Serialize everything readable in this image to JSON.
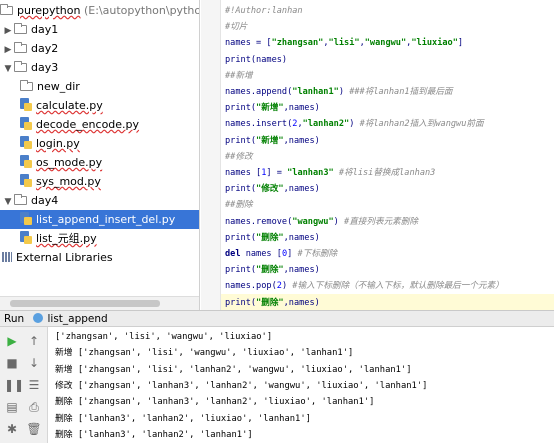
{
  "project_tree": {
    "root": {
      "name": "purepython",
      "path": "(E:\\autopython\\pythoncod"
    },
    "items": [
      {
        "label": "day1",
        "kind": "folder",
        "expanded": false,
        "depth": 0
      },
      {
        "label": "day2",
        "kind": "folder",
        "expanded": false,
        "depth": 0
      },
      {
        "label": "day3",
        "kind": "folder",
        "expanded": true,
        "depth": 0
      },
      {
        "label": "new_dir",
        "kind": "folder",
        "depth": 1
      },
      {
        "label": "calculate.py",
        "kind": "python",
        "depth": 1
      },
      {
        "label": "decode_encode.py",
        "kind": "python",
        "depth": 1
      },
      {
        "label": "login.py",
        "kind": "python",
        "depth": 1
      },
      {
        "label": "os_mode.py",
        "kind": "python",
        "depth": 1
      },
      {
        "label": "sys_mod.py",
        "kind": "python",
        "depth": 1
      },
      {
        "label": "day4",
        "kind": "folder",
        "expanded": true,
        "depth": 0
      },
      {
        "label": "list_append_insert_del.py",
        "kind": "python",
        "depth": 1,
        "selected": true
      },
      {
        "label": "list_元组.py",
        "kind": "python",
        "depth": 1
      },
      {
        "label": "External Libraries",
        "kind": "library",
        "depth": 0
      }
    ]
  },
  "editor": {
    "lines": [
      {
        "seg": [
          [
            "#!Author:lanhan",
            "cm"
          ]
        ]
      },
      {
        "seg": [
          [
            "#切片",
            "cm"
          ]
        ]
      },
      {
        "seg": [
          [
            "names = [",
            "bl"
          ],
          [
            "\"zhangsan\"",
            "st"
          ],
          [
            ",",
            "bl"
          ],
          [
            "\"lisi\"",
            "st"
          ],
          [
            ",",
            "bl"
          ],
          [
            "\"wangwu\"",
            "st"
          ],
          [
            ",",
            "bl"
          ],
          [
            "\"liuxiao\"",
            "st"
          ],
          [
            "]",
            "bl"
          ]
        ]
      },
      {
        "seg": [
          [
            "print(names)",
            "bl"
          ]
        ]
      },
      {
        "seg": [
          [
            "##新增",
            "cm"
          ]
        ]
      },
      {
        "seg": [
          [
            "names.append(",
            "bl"
          ],
          [
            "\"lanhan1\"",
            "st"
          ],
          [
            ")  ",
            "bl"
          ],
          [
            "###将lanhan1插到最后面",
            "cm"
          ]
        ]
      },
      {
        "seg": [
          [
            "print(",
            "bl"
          ],
          [
            "\"新增\"",
            "st"
          ],
          [
            ",names)",
            "bl"
          ]
        ]
      },
      {
        "seg": [
          [
            "names.insert(",
            "bl"
          ],
          [
            "2",
            "nm"
          ],
          [
            ",",
            "bl"
          ],
          [
            "\"lanhan2\"",
            "st"
          ],
          [
            ")  ",
            "bl"
          ],
          [
            "#将lanhan2插入到wangwu前面",
            "cm"
          ]
        ]
      },
      {
        "seg": [
          [
            "print(",
            "bl"
          ],
          [
            "\"新增\"",
            "st"
          ],
          [
            ",names)",
            "bl"
          ]
        ]
      },
      {
        "seg": [
          [
            "##修改",
            "cm"
          ]
        ]
      },
      {
        "seg": [
          [
            "names [",
            "bl"
          ],
          [
            "1",
            "nm"
          ],
          [
            "] = ",
            "bl"
          ],
          [
            "\"lanhan3\"",
            "st"
          ],
          [
            "  ",
            "bl"
          ],
          [
            "#将lisi替换成lanhan3",
            "cm"
          ]
        ]
      },
      {
        "seg": [
          [
            "print(",
            "bl"
          ],
          [
            "\"修改\"",
            "st"
          ],
          [
            ",names)",
            "bl"
          ]
        ]
      },
      {
        "seg": [
          [
            "##删除",
            "cm"
          ]
        ]
      },
      {
        "seg": [
          [
            "names.remove(",
            "bl"
          ],
          [
            "\"wangwu\"",
            "st"
          ],
          [
            ")     ",
            "bl"
          ],
          [
            "#直接列表元素删除",
            "cm"
          ]
        ]
      },
      {
        "seg": [
          [
            "print(",
            "bl"
          ],
          [
            "\"删除\"",
            "st"
          ],
          [
            ",names)",
            "bl"
          ]
        ]
      },
      {
        "seg": [
          [
            "del",
            "kw"
          ],
          [
            " names [",
            "bl"
          ],
          [
            "0",
            "nm"
          ],
          [
            "]     ",
            "bl"
          ],
          [
            "#下标删除",
            "cm"
          ]
        ]
      },
      {
        "seg": [
          [
            "print(",
            "bl"
          ],
          [
            "\"删除\"",
            "st"
          ],
          [
            ",names)",
            "bl"
          ]
        ]
      },
      {
        "seg": [
          [
            "names.pop(",
            "bl"
          ],
          [
            "2",
            "nm"
          ],
          [
            ")     ",
            "bl"
          ],
          [
            "#输入下标删除（不输入下标，默认删除最后一个元素）",
            "cm"
          ]
        ]
      },
      {
        "seg": [
          [
            "print(",
            "bl"
          ],
          [
            "\"删除\"",
            "st"
          ],
          [
            ",names)",
            "bl"
          ]
        ],
        "current": true
      }
    ]
  },
  "run_bar": {
    "label": "Run",
    "config": "list_append"
  },
  "console": {
    "lines": [
      "['zhangsan', 'lisi', 'wangwu', 'liuxiao']",
      "新增 ['zhangsan', 'lisi', 'wangwu', 'liuxiao', 'lanhan1']",
      "新增 ['zhangsan', 'lisi', 'lanhan2', 'wangwu', 'liuxiao', 'lanhan1']",
      "修改 ['zhangsan', 'lanhan3', 'lanhan2', 'wangwu', 'liuxiao', 'lanhan1']",
      "删除 ['zhangsan', 'lanhan3', 'lanhan2', 'liuxiao', 'lanhan1']",
      "删除 ['lanhan3', 'lanhan2', 'liuxiao', 'lanhan1']",
      "删除 ['lanhan3', 'lanhan2', 'lanhan1']"
    ]
  },
  "toolbar_icons": [
    "play-icon",
    "up-arrow-icon",
    "stop-icon",
    "down-arrow-icon",
    "pause-icon",
    "wrap-icon",
    "layout-icon",
    "print-icon",
    "pin-icon",
    "trash-icon"
  ],
  "colors": {
    "selection": "#3875d7",
    "current_line": "#fffbd6",
    "run_green": "#3cb043",
    "string_green": "#008000",
    "keyword_navy": "#000080"
  }
}
